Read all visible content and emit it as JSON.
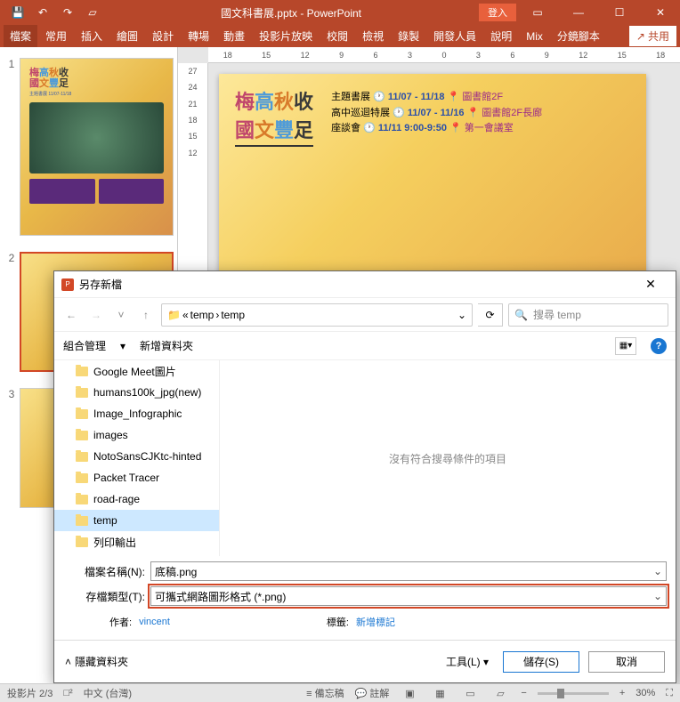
{
  "titlebar": {
    "title": "國文科書展.pptx - PowerPoint",
    "login": "登入"
  },
  "ribbon": {
    "tabs": [
      "檔案",
      "常用",
      "插入",
      "繪圖",
      "設計",
      "轉場",
      "動畫",
      "投影片放映",
      "校閱",
      "檢視",
      "錄製",
      "開發人員",
      "說明",
      "Mix",
      "分鏡腳本"
    ],
    "share": "共用"
  },
  "ruler_h": [
    "18",
    "15",
    "12",
    "9",
    "6",
    "3",
    "0",
    "3",
    "6",
    "9",
    "12",
    "15",
    "18"
  ],
  "ruler_v": [
    "27",
    "24",
    "21",
    "18",
    "15",
    "12"
  ],
  "slide": {
    "title1": "梅",
    "title2": "高",
    "title3": "秋",
    "title4": "收",
    "sub1": "國",
    "sub2": "文",
    "sub3": "豐",
    "sub4": "足",
    "row1a": "主題書展",
    "row1b": "11/07 - 11/18",
    "row1c": "圖書館2F",
    "row2a": "高中巡迴特展",
    "row2b": "11/07 - 11/16",
    "row2c": "圖書館2F長廊",
    "row3a": "座談會",
    "row3b": "11/11 9:00-9:50",
    "row3c": "第一會議室"
  },
  "thumbs": {
    "n1": "1",
    "n2": "2",
    "n3": "3"
  },
  "dialog": {
    "title": "另存新檔",
    "path_seg1": "temp",
    "path_seg2": "temp",
    "search_placeholder": "搜尋 temp",
    "organize": "組合管理",
    "new_folder": "新增資料夾",
    "tree": [
      "Google Meet圖片",
      "humans100k_jpg(new)",
      "Image_Infographic",
      "images",
      "NotoSansCJKtc-hinted",
      "Packet Tracer",
      "road-rage",
      "temp",
      "列印輸出"
    ],
    "empty_msg": "沒有符合搜尋條件的項目",
    "filename_label": "檔案名稱(N):",
    "filename_value": "底稿.png",
    "filetype_label": "存檔類型(T):",
    "filetype_value": "可攜式網路圖形格式 (*.png)",
    "author_label": "作者:",
    "author_value": "vincent",
    "tags_label": "標籤:",
    "tags_value": "新增標記",
    "hide_folders": "隱藏資料夾",
    "tools": "工具(L)",
    "save": "儲存(S)",
    "cancel": "取消"
  },
  "status": {
    "slide_count": "投影片 2/3",
    "lang": "中文 (台灣)",
    "notes": "備忘稿",
    "comments": "註解",
    "zoom": "30%"
  }
}
